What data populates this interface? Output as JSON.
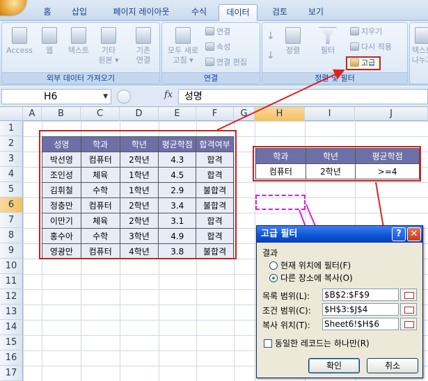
{
  "ribbon": {
    "tabs": [
      "홈",
      "삽입",
      "페이지 레이아웃",
      "수식",
      "데이터",
      "검토",
      "보기"
    ],
    "active_tab": "데이터",
    "external_group": {
      "label": "외부 데이터 가져오기",
      "access": "Access",
      "web": "웹",
      "text": "텍스트",
      "other_line1": "기타",
      "other_line2": "원본 ▾",
      "existing_line1": "기존",
      "existing_line2": "연결"
    },
    "connections_group": {
      "label": "연결",
      "refresh_line1": "모두 새로",
      "refresh_line2": "고침 ▾",
      "connections": "연결",
      "properties": "속성",
      "edit_links": "연결 편집"
    },
    "sort_group": {
      "label": "정렬 및 필터",
      "sort_az": "공↓",
      "sort": "정렬",
      "filter": "필터",
      "clear": "지우기",
      "reapply": "다시 적용",
      "advanced": "고급"
    },
    "tools_group": {
      "text_to_cols_line1": "텍스트",
      "text_to_cols_line2": "나누기"
    }
  },
  "formula_bar": {
    "cell_ref": "H6",
    "fx": "fx",
    "value": "성명"
  },
  "grid": {
    "columns": [
      "A",
      "B",
      "C",
      "D",
      "E",
      "F",
      "G",
      "H",
      "I",
      "J"
    ],
    "selected_column": "H",
    "rows": [
      "1",
      "2",
      "3",
      "4",
      "5",
      "6",
      "7",
      "8",
      "9",
      "10",
      "11",
      "12",
      "13",
      "14",
      "15",
      "16",
      "17"
    ],
    "selected_row": "6"
  },
  "source_table": {
    "headers": [
      "성명",
      "학과",
      "학년",
      "평균학점",
      "합격여부"
    ],
    "rows": [
      [
        "박선영",
        "컴퓨터",
        "2학년",
        "4.3",
        "합격"
      ],
      [
        "조인성",
        "체육",
        "1학년",
        "4.5",
        "합격"
      ],
      [
        "김휘철",
        "수학",
        "1학년",
        "2.9",
        "불합격"
      ],
      [
        "정충만",
        "컴퓨터",
        "2학년",
        "3.4",
        "불합격"
      ],
      [
        "이만기",
        "체육",
        "2학년",
        "3.1",
        "합격"
      ],
      [
        "홍수아",
        "수학",
        "3학년",
        "4.9",
        "합격"
      ],
      [
        "영광만",
        "컴퓨터",
        "4학년",
        "3.8",
        "불합격"
      ]
    ]
  },
  "criteria_table": {
    "headers": [
      "학과",
      "학년",
      "평균학점"
    ],
    "row": [
      "컴퓨터",
      "2학년",
      ">=4"
    ]
  },
  "dialog": {
    "title": "고급 필터",
    "help": "?",
    "close": "✕",
    "result_label": "결과",
    "option_inplace": "현재 위치에 필터(F)",
    "option_copy": "다른 장소에 복사(O)",
    "list_range_label": "목록 범위(L):",
    "list_range_value": "$B$2:$F$9",
    "criteria_range_label": "조건 범위(C):",
    "criteria_range_value": "$H$3:$J$4",
    "copy_to_label": "복사 위치(T):",
    "copy_to_value": "Sheet6!$H$6",
    "unique_label": "동일한 레코드는 하나만(R)",
    "ok": "확인",
    "cancel": "취소"
  },
  "colors": {
    "table_header": "#6f6fa8",
    "highlight_red": "#c8201f",
    "highlight_magenta": "#d41fd4"
  }
}
